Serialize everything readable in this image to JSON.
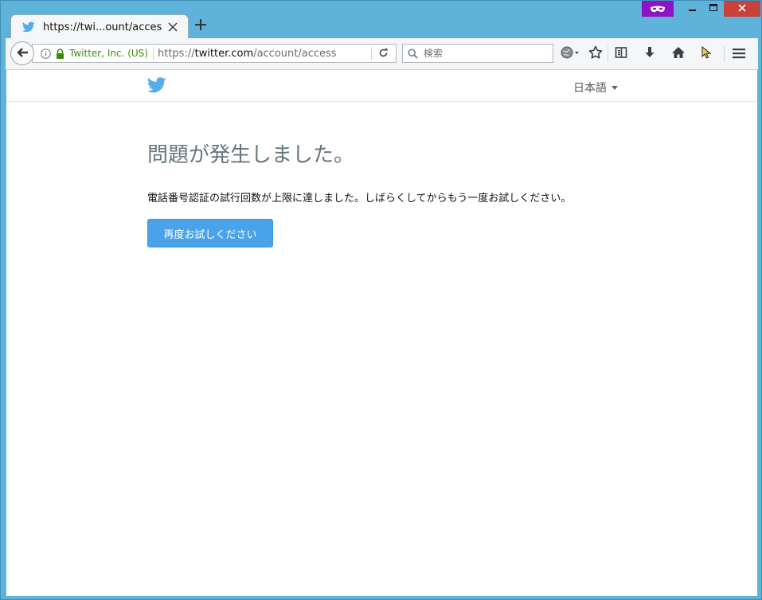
{
  "browser": {
    "tab_title": "https://twi...ount/access",
    "identity_label": "Twitter, Inc. (US)",
    "url_prefix": "https://",
    "url_host": "twitter.com",
    "url_path": "/account/access",
    "search_placeholder": "検索"
  },
  "page": {
    "language_label": "日本語",
    "heading": "問題が発生しました。",
    "message": "電話番号認証の試行回数が上限に達しました。しばらくしてからもう一度お試しください。",
    "retry_button": "再度お試しください"
  },
  "colors": {
    "twitter_blue": "#55acee",
    "button_blue": "#4aa3e8",
    "heading_gray": "#66757f",
    "identity_green": "#3d8a13",
    "private_purple": "#8e13c4",
    "close_red": "#c8413a"
  },
  "icons": [
    "private-mask-icon",
    "minimize-icon",
    "maximize-icon",
    "close-icon",
    "twitter-bird-icon",
    "tab-close-icon",
    "plus-icon",
    "back-arrow-icon",
    "info-icon",
    "lock-icon",
    "reload-icon",
    "search-icon",
    "globe-icon",
    "star-icon",
    "reading-list-icon",
    "download-icon",
    "home-icon",
    "cursor-icon",
    "hamburger-menu-icon"
  ]
}
